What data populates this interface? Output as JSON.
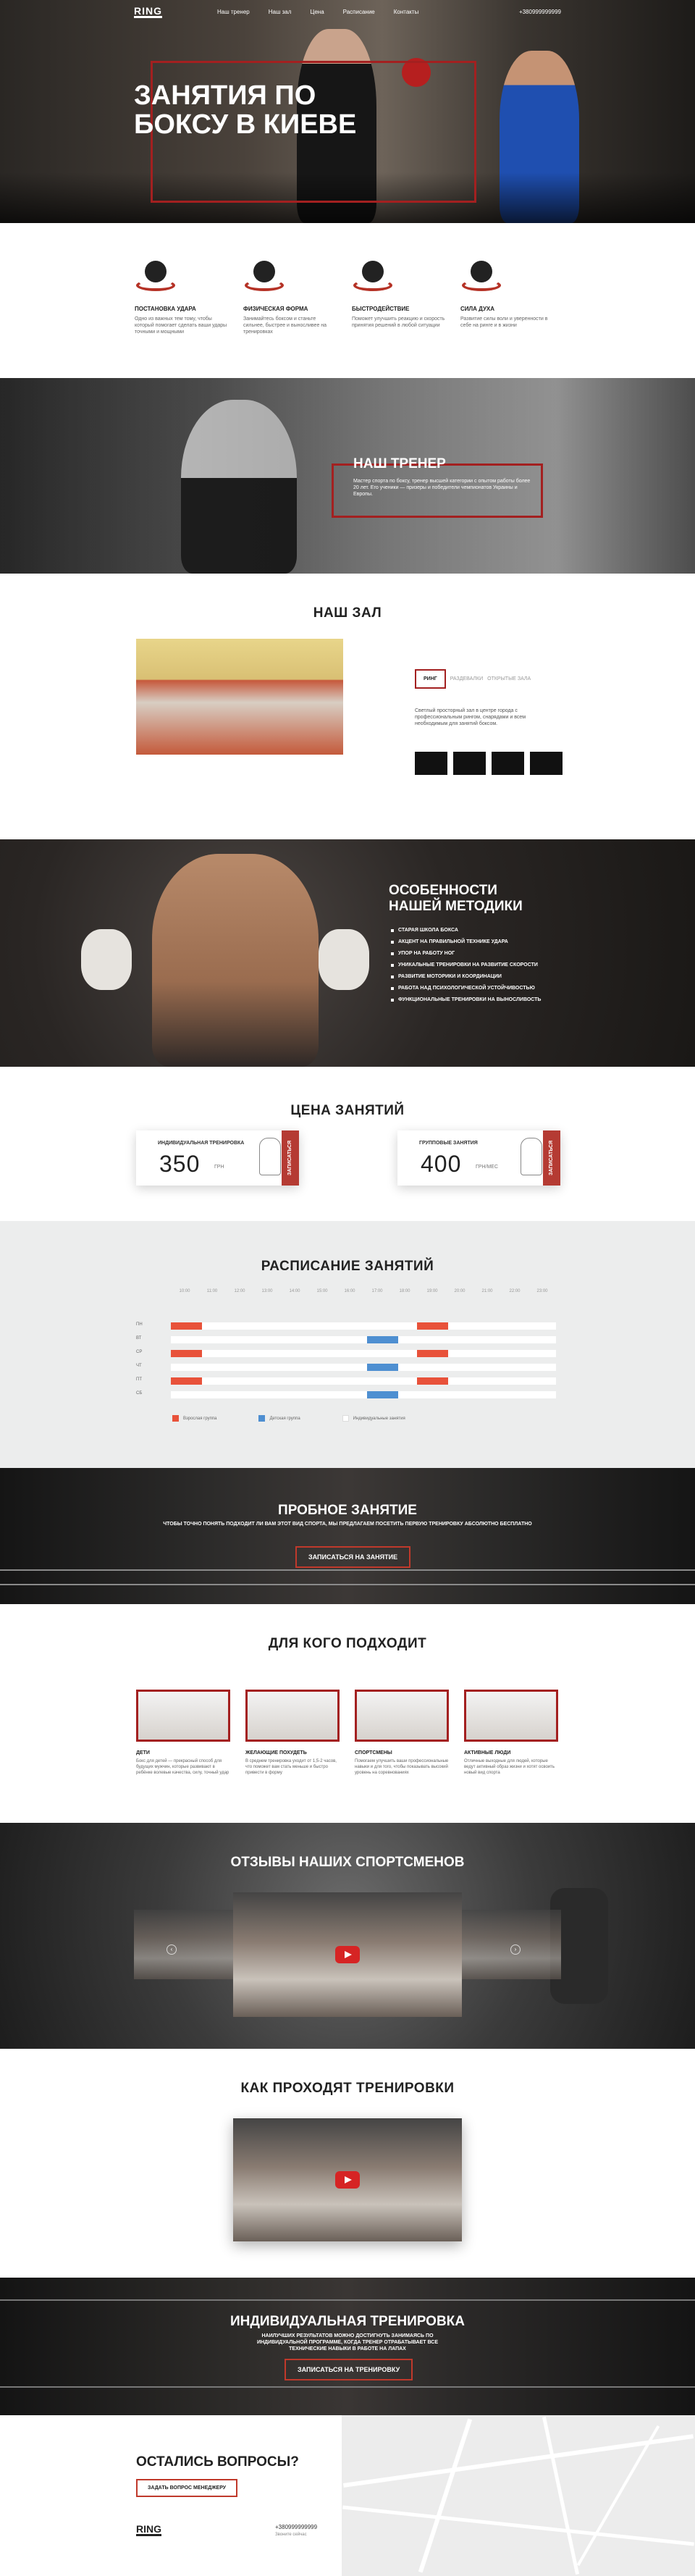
{
  "nav": {
    "logo": "RING",
    "items": [
      "Наш тренер",
      "Наш зал",
      "Цена",
      "Расписание",
      "Контакты"
    ],
    "phone": "+380999999999"
  },
  "hero": {
    "title": "Занятия по боксу в Киеве"
  },
  "features": [
    {
      "title": "Постановка удара",
      "text": "Одно из важных тем тому, чтобы который помогает сделать ваши удары точными и мощными"
    },
    {
      "title": "Физическая форма",
      "text": "Занимайтесь боксом и станьте сильнее, быстрее и выносливее на тренировках"
    },
    {
      "title": "Быстродействие",
      "text": "Поможет улучшить реакцию и скорость принятия решений в любой ситуации"
    },
    {
      "title": "Сила духа",
      "text": "Развитие силы воли и уверенности в себе на ринге и в жизни"
    }
  ],
  "trainer": {
    "title": "Наш тренер",
    "text": "Мастер спорта по боксу, тренер высшей категории с опытом работы более 20 лет. Его ученики — призеры и победители чемпионатов Украины и Европы."
  },
  "hall": {
    "title": "Наш зал",
    "tabs": [
      "Ринг",
      "Раздевалки",
      "Открытые зала"
    ],
    "text": "Светлый просторный зал в центре города с профессиональным рингом, снарядами и всем необходимым для занятий боксом."
  },
  "method": {
    "title": "Особенности нашей методики",
    "items": [
      "Старая школа бокса",
      "Акцент на правильной технике удара",
      "Упор на работу ног",
      "Уникальные тренировки на развитие скорости",
      "Развитие моторики и координации",
      "Работа над психологической устойчивостью",
      "Функциональные тренировки на выносливость"
    ]
  },
  "price": {
    "title": "Цена занятий",
    "cards": [
      {
        "label": "Индивидуальная тренировка",
        "value": "350",
        "unit": "грн",
        "tag": "Записаться"
      },
      {
        "label": "Групповые занятия",
        "value": "400",
        "unit": "грн/мес",
        "tag": "Записаться"
      }
    ]
  },
  "schedule": {
    "title": "Расписание занятий",
    "times": [
      "10:00",
      "11:00",
      "12:00",
      "13:00",
      "14:00",
      "15:00",
      "16:00",
      "17:00",
      "18:00",
      "19:00",
      "20:00",
      "21:00",
      "22:00",
      "23:00"
    ],
    "days": [
      "ПН",
      "ВТ",
      "СР",
      "ЧТ",
      "ПТ",
      "СБ"
    ],
    "legend": [
      {
        "label": "Взрослая группа",
        "color": "#e8523a"
      },
      {
        "label": "Детская группа",
        "color": "#4e8fd1"
      },
      {
        "label": "Индивидуальные занятия",
        "color": "#ffffff"
      }
    ],
    "blocks": [
      {
        "day": 0,
        "start": 0.0,
        "width": 0.08,
        "color": "#e8523a"
      },
      {
        "day": 0,
        "start": 0.64,
        "width": 0.08,
        "color": "#e8523a"
      },
      {
        "day": 1,
        "start": 0.51,
        "width": 0.08,
        "color": "#4e8fd1"
      },
      {
        "day": 2,
        "start": 0.0,
        "width": 0.08,
        "color": "#e8523a"
      },
      {
        "day": 2,
        "start": 0.64,
        "width": 0.08,
        "color": "#e8523a"
      },
      {
        "day": 3,
        "start": 0.51,
        "width": 0.08,
        "color": "#4e8fd1"
      },
      {
        "day": 4,
        "start": 0.0,
        "width": 0.08,
        "color": "#e8523a"
      },
      {
        "day": 4,
        "start": 0.64,
        "width": 0.08,
        "color": "#e8523a"
      },
      {
        "day": 5,
        "start": 0.51,
        "width": 0.08,
        "color": "#4e8fd1"
      }
    ]
  },
  "trial": {
    "title": "Пробное занятие",
    "text": "Чтобы точно понять подходит ли вам этот вид спорта, мы предлагаем посетить первую тренировку абсолютно бесплатно",
    "button": "Записаться на занятие"
  },
  "audience": {
    "title": "Для кого подходит",
    "items": [
      {
        "title": "Дети",
        "text": "Бокс для детей — прекрасный способ для будущих мужчин, которые развивают в ребёнке волевые качества, силу, точный удар"
      },
      {
        "title": "Желающие похудеть",
        "text": "В среднем тренировка уходит от 1,5-2 часов, что поможет вам стать меньше и быстро привести в форму"
      },
      {
        "title": "Спортсмены",
        "text": "Помогаем улучшить ваши профессиональные навыки и для того, чтобы показывать высокий уровень на соревнованиях"
      },
      {
        "title": "Активные люди",
        "text": "Отличные выходные для людей, которые ведут активный образ жизни и хотят освоить новый вид спорта"
      }
    ]
  },
  "reviews": {
    "title": "Отзывы наших спортсменов"
  },
  "how": {
    "title": "Как проходят тренировки"
  },
  "individual": {
    "title": "Индивидуальная тренировка",
    "text": "Наилучших результатов можно достигнуть занимаясь по индивидуальной программе, когда тренер отрабатывает все технические навыки в работе на лапах",
    "button": "Записаться на тренировку"
  },
  "contacts": {
    "title": "Остались вопросы?",
    "button": "Задать вопрос менеджеру",
    "logo": "RING",
    "phone": "+380999999999",
    "phone_note": "Звоните сейчас"
  }
}
